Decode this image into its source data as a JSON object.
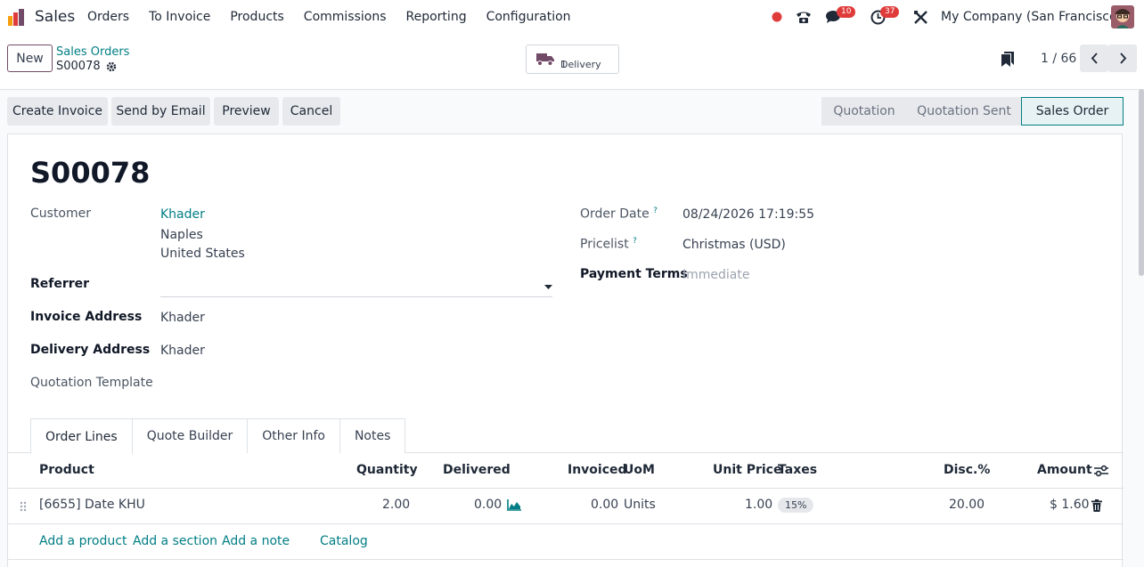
{
  "nav": {
    "app_name": "Sales",
    "menu": [
      "Orders",
      "To Invoice",
      "Products",
      "Commissions",
      "Reporting",
      "Configuration"
    ],
    "messages_count": "10",
    "activities_count": "37",
    "company": "My Company (San Francisco)"
  },
  "control_panel": {
    "new_label": "New",
    "breadcrumb_parent": "Sales Orders",
    "breadcrumb_current": "S00078",
    "smart_button": {
      "label": "Delivery",
      "count": "1"
    },
    "pager": "1 / 66"
  },
  "actions": [
    "Create Invoice",
    "Send by Email",
    "Preview",
    "Cancel"
  ],
  "statusbar": [
    "Quotation",
    "Quotation Sent",
    "Sales Order"
  ],
  "record": {
    "name": "S00078",
    "customer_label": "Customer",
    "customer_name": "Khader",
    "customer_city": "Naples",
    "customer_country": "United States",
    "referrer_label": "Referrer",
    "invoice_address_label": "Invoice Address",
    "invoice_address": "Khader",
    "delivery_address_label": "Delivery Address",
    "delivery_address": "Khader",
    "quotation_template_label": "Quotation Template",
    "order_date_label": "Order Date",
    "order_date": "08/24/2026 17:19:55",
    "pricelist_label": "Pricelist",
    "pricelist": "Christmas (USD)",
    "payment_terms_label": "Payment Terms",
    "payment_terms_placeholder": "Immediate",
    "help_mark": "?"
  },
  "tabs": [
    "Order Lines",
    "Quote Builder",
    "Other Info",
    "Notes"
  ],
  "table": {
    "headers": [
      "Product",
      "Quantity",
      "Delivered",
      "Invoiced",
      "UoM",
      "Unit Price",
      "Taxes",
      "Disc.%",
      "Amount"
    ],
    "rows": [
      {
        "product": "[6655] Date KHU",
        "quantity": "2.00",
        "delivered": "0.00",
        "invoiced": "0.00",
        "uom": "Units",
        "unit_price": "1.00",
        "taxes": "15%",
        "discount": "20.00",
        "amount": "$ 1.60"
      }
    ],
    "add_links": [
      "Add a product",
      "Add a section",
      "Add a note",
      "Catalog"
    ]
  }
}
